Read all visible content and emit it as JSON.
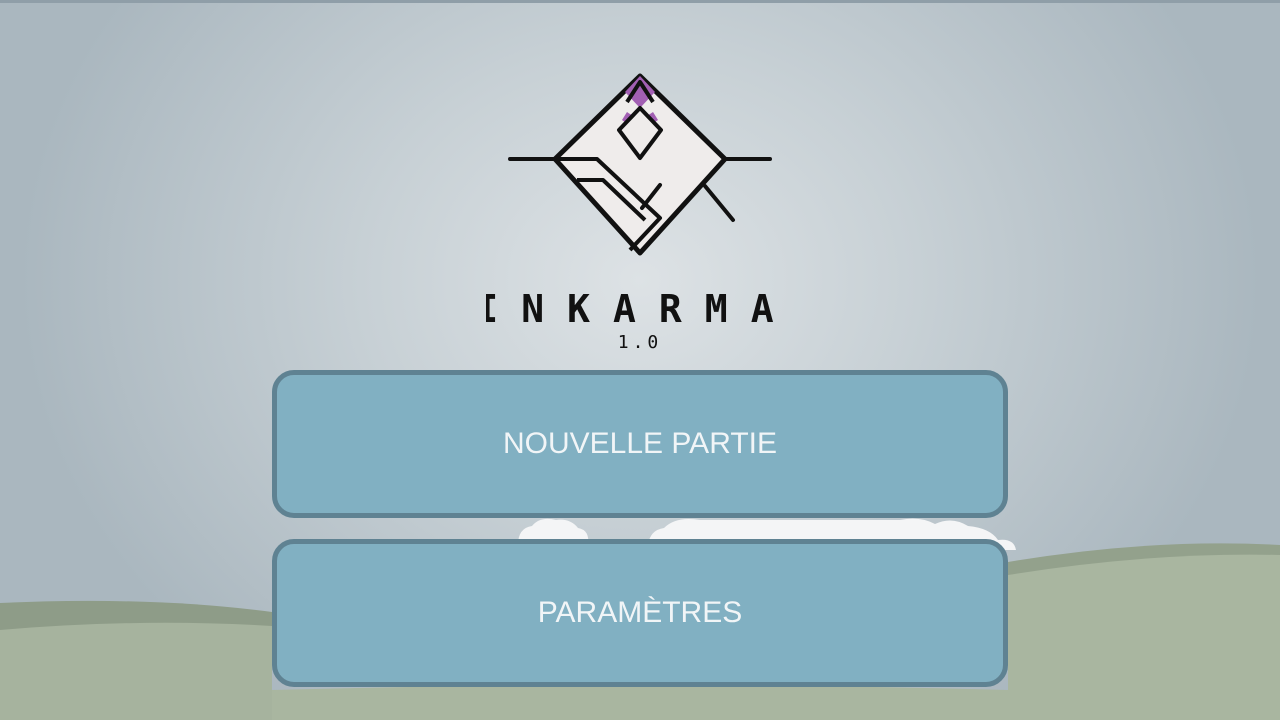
{
  "game": {
    "title": "INKARMA",
    "version": "1.0"
  },
  "menu": {
    "new_game_label": "NOUVELLE PARTIE",
    "settings_label": "PARAMÈTRES"
  },
  "colors": {
    "sky_center": "#dde2e5",
    "sky_edge": "#aab7bf",
    "button_fill": "#81b0c2",
    "button_border": "#5f8292",
    "button_text": "#f1f5f7",
    "hill_front": "#a9b6a0",
    "hill_back": "#8c9a86",
    "logo_accent": "#a25fb3",
    "logo_fill": "#efeceb"
  }
}
